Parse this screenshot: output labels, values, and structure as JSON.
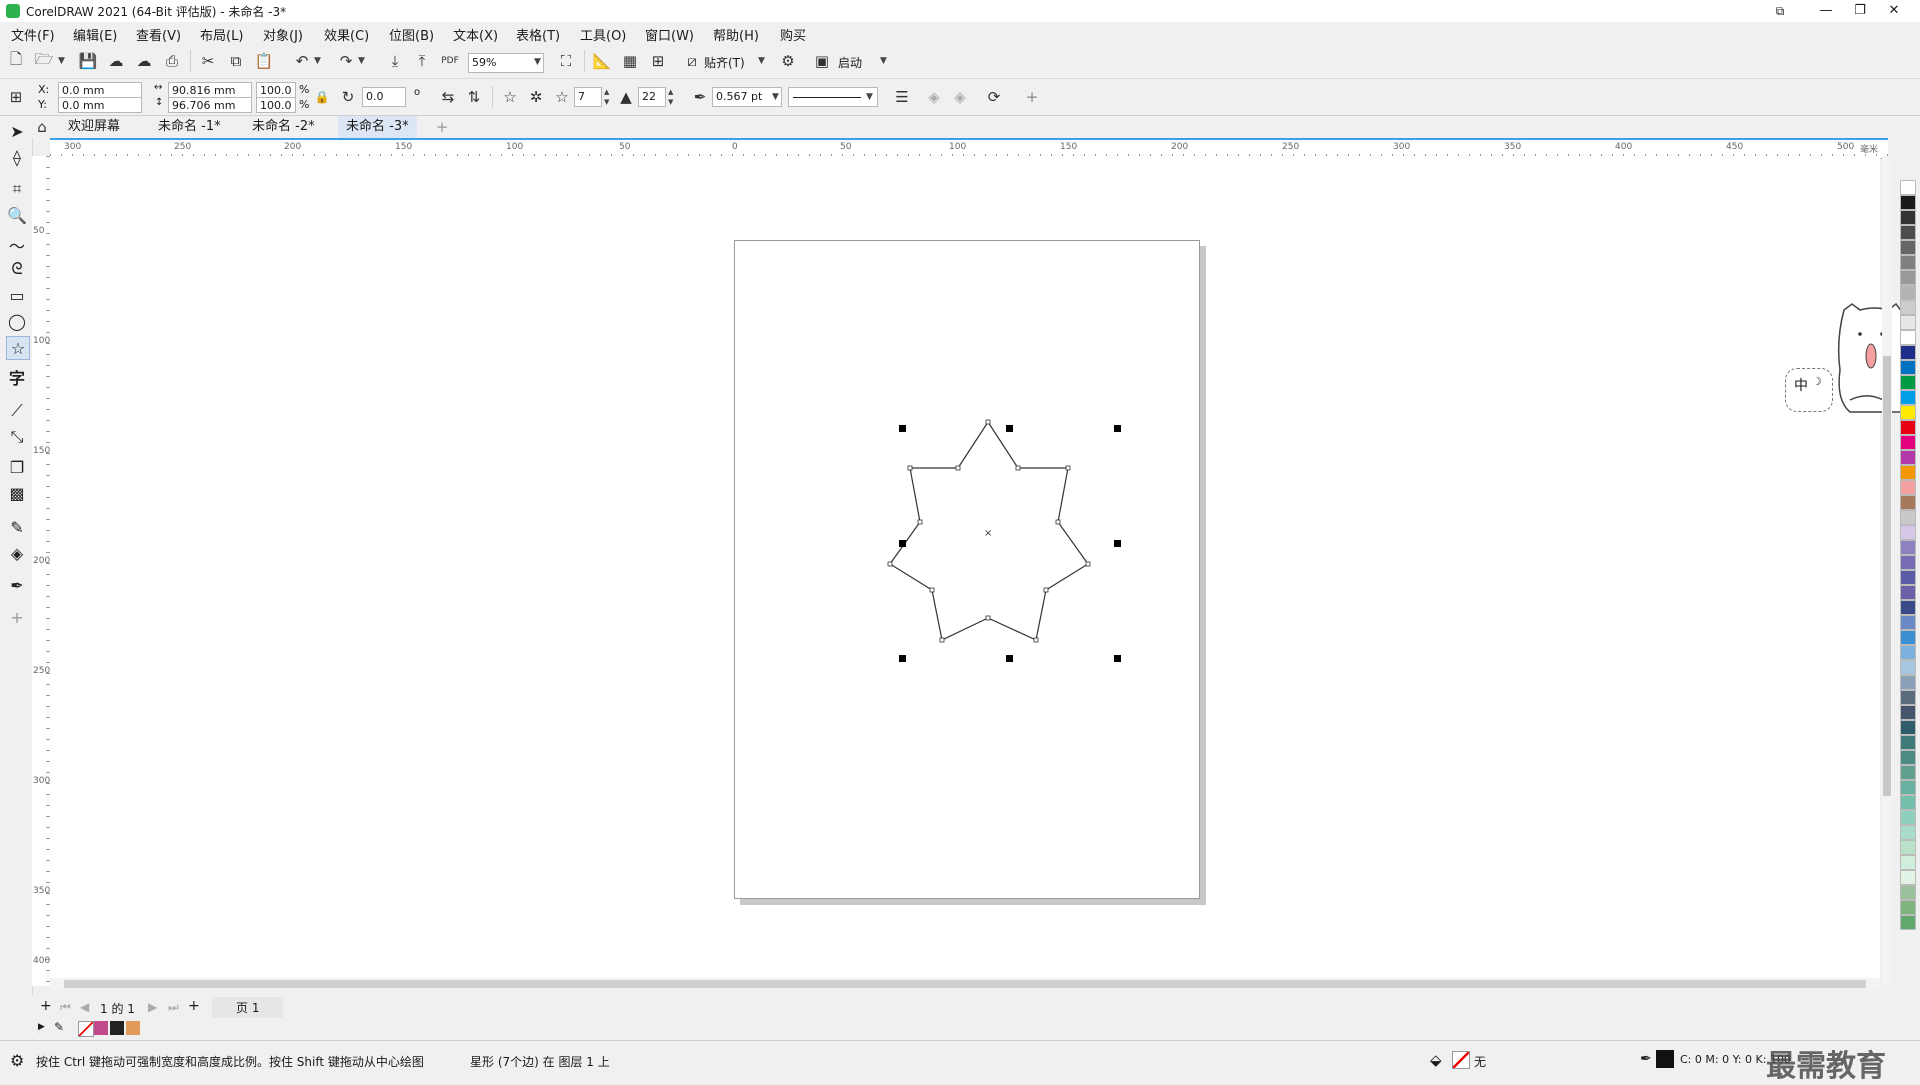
{
  "window": {
    "title": "CorelDRAW 2021 (64-Bit 评估版) - 未命名 -3*",
    "buttons": {
      "profile": "⧉",
      "minimize": "—",
      "restore": "❐",
      "close": "✕"
    }
  },
  "menu": [
    "文件(F)",
    "编辑(E)",
    "查看(V)",
    "布局(L)",
    "对象(J)",
    "效果(C)",
    "位图(B)",
    "文本(X)",
    "表格(T)",
    "工具(O)",
    "窗口(W)",
    "帮助(H)",
    "购买"
  ],
  "toolbar": {
    "zoom": "59%",
    "snap_label": "贴齐(T)",
    "launch_label": "启动"
  },
  "properties": {
    "x_label": "X:",
    "y_label": "Y:",
    "x": "0.0 mm",
    "y": "0.0 mm",
    "width": "90.816 mm",
    "height": "96.706 mm",
    "scale_w": "100.0",
    "scale_h": "100.0",
    "percent": "%",
    "rotation": "0.0",
    "degree": "o",
    "points": "7",
    "sharpness": "22",
    "outline_width": "0.567 pt"
  },
  "tabs": {
    "welcome": "欢迎屏幕",
    "doc1": "未命名 -1*",
    "doc2": "未命名 -2*",
    "doc3": "未命名 -3*"
  },
  "ruler": {
    "h_labels": [
      "300",
      "250",
      "200",
      "150",
      "100",
      "50",
      "0",
      "50",
      "100",
      "150",
      "200",
      "250",
      "300",
      "350",
      "400",
      "450",
      "500"
    ],
    "unit": "毫米",
    "v_labels": [
      "50",
      "100",
      "150",
      "200",
      "250",
      "300",
      "350",
      "400"
    ]
  },
  "pagenav": {
    "indicator": "1 的 1",
    "page_tab": "页 1"
  },
  "status": {
    "hint": "按住 Ctrl 键拖动可强制宽度和高度成比例。按住 Shift 键拖动从中心绘图",
    "object_info": "星形 (7个边) 在 图层 1 上",
    "fill_label": "无",
    "color_readout": "C: 0 M: 0 Y: 0 K: 100"
  },
  "ime_badge": {
    "text": "中",
    "moon": "☽"
  },
  "watermark": "最需教育",
  "colors": {
    "accent": "#3aa0e8",
    "selection_handle": "#000000",
    "active_tab": "#dce6f4"
  },
  "palette": [
    "#ffffff",
    "#1a1a1a",
    "#333333",
    "#4d4d4d",
    "#666666",
    "#808080",
    "#999999",
    "#b3b3b3",
    "#cccccc",
    "#e6e6e6",
    "#ffffff",
    "#1d2f8a",
    "#0070c0",
    "#009944",
    "#00a0e9",
    "#ffea00",
    "#e60012",
    "#e4007f",
    "#b23aa8",
    "#f39800",
    "#f5a0a0",
    "#a57a5a",
    "#c9c9c9",
    "#d6c6e8",
    "#8f80c0",
    "#7a6bb5",
    "#5b5ba8",
    "#6a60a8",
    "#3c4a8a",
    "#6a8ac6",
    "#3b8ed0",
    "#7fb1df",
    "#a7c5e0",
    "#8aa0b6",
    "#5a6b7e",
    "#44546a",
    "#2f5b6a",
    "#3f7a7a",
    "#4d8c84",
    "#5fa08f",
    "#69b0a0",
    "#74c0ad",
    "#8fcfbd",
    "#a8dcc9",
    "#b9e2c9",
    "#cfeedc",
    "#e2f4e7",
    "#9cc09c",
    "#7fb47f",
    "#60a86b"
  ]
}
